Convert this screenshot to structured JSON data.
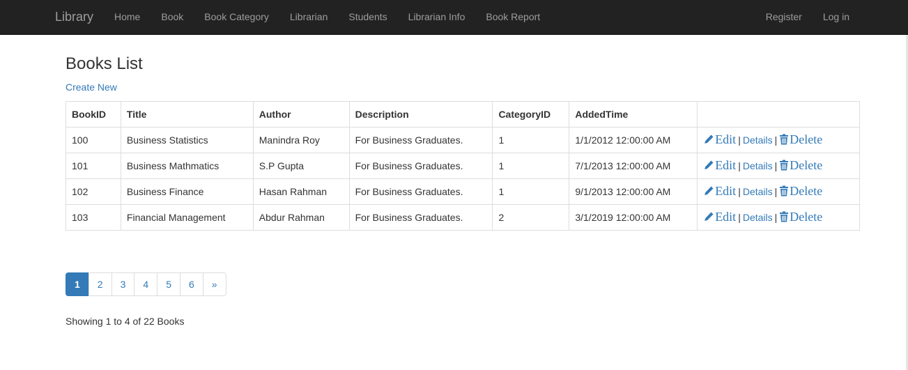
{
  "navbar": {
    "brand": "Library",
    "links": [
      "Home",
      "Book",
      "Book Category",
      "Librarian",
      "Students",
      "Librarian Info",
      "Book Report"
    ],
    "right_links": [
      "Register",
      "Log in"
    ]
  },
  "page": {
    "title": "Books List",
    "create_new": "Create New"
  },
  "table": {
    "headers": [
      "BookID",
      "Title",
      "Author",
      "Description",
      "CategoryID",
      "AddedTime",
      ""
    ],
    "rows": [
      {
        "id": "100",
        "title": "Business Statistics",
        "author": "Manindra Roy",
        "description": "For Business Graduates.",
        "category": "1",
        "added": "1/1/2012 12:00:00 AM"
      },
      {
        "id": "101",
        "title": "Business Mathmatics",
        "author": "S.P Gupta",
        "description": "For Business Graduates.",
        "category": "1",
        "added": "7/1/2013 12:00:00 AM"
      },
      {
        "id": "102",
        "title": "Business Finance",
        "author": "Hasan Rahman",
        "description": "For Business Graduates.",
        "category": "1",
        "added": "9/1/2013 12:00:00 AM"
      },
      {
        "id": "103",
        "title": "Financial Management",
        "author": "Abdur Rahman",
        "description": "For Business Graduates.",
        "category": "2",
        "added": "3/1/2019 12:00:00 AM"
      }
    ],
    "actions": {
      "edit": "Edit",
      "details": "Details",
      "delete": "Delete",
      "separator": "|",
      "edit_icon": "pencil-icon",
      "delete_icon": "trash-icon"
    }
  },
  "pagination": {
    "pages": [
      "1",
      "2",
      "3",
      "4",
      "5",
      "6",
      "»"
    ],
    "current": "1"
  },
  "footer": {
    "showing": "Showing 1 to 4 of 22 Books"
  },
  "colors": {
    "navbar_bg": "#222222",
    "nav_text": "#9d9d9d",
    "link": "#337ab7",
    "active_page_bg": "#337ab7",
    "border": "#dddddd"
  }
}
